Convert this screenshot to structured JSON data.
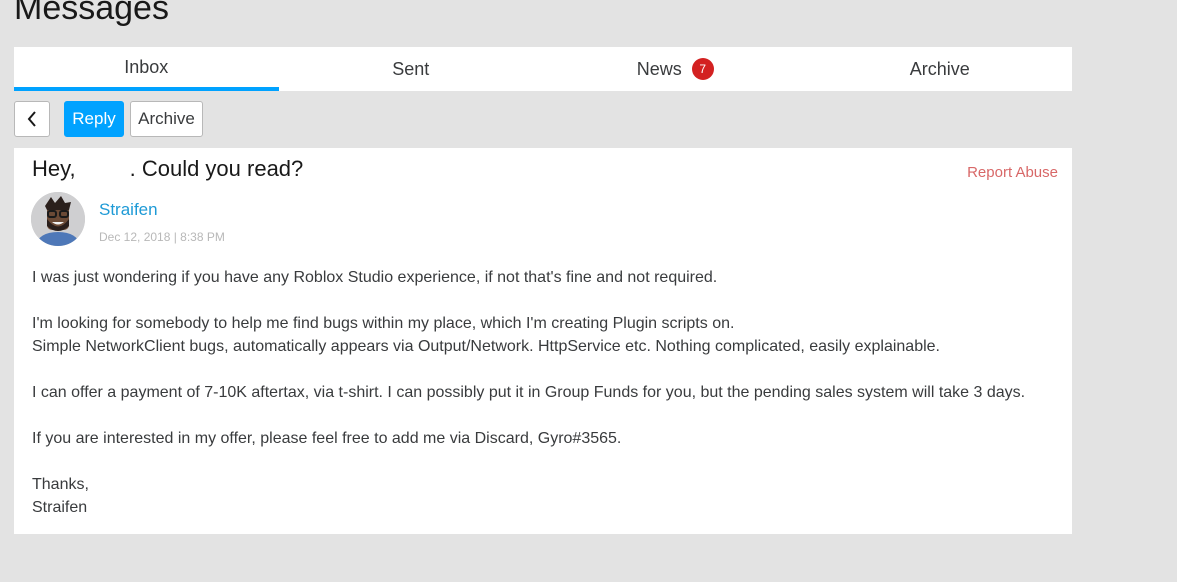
{
  "page": {
    "title": "Messages"
  },
  "tabs": [
    {
      "label": "Inbox",
      "active": true
    },
    {
      "label": "Sent",
      "active": false
    },
    {
      "label": "News",
      "active": false,
      "badge": "7"
    },
    {
      "label": "Archive",
      "active": false
    }
  ],
  "toolbar": {
    "back_icon": "chevron-left-icon",
    "reply_label": "Reply",
    "archive_label": "Archive"
  },
  "message": {
    "subject_prefix": "Hey,",
    "subject_suffix": ". Could you read?",
    "report_label": "Report Abuse",
    "sender": "Straifen",
    "date": "Dec 12, 2018 | 8:38 PM",
    "body": [
      "I was just wondering if you have any Roblox Studio experience, if not that's fine and not required.",
      "",
      "I'm looking for somebody to help me find bugs within my place, which I'm creating Plugin scripts on.",
      "Simple NetworkClient bugs, automatically appears via Output/Network. HttpService etc. Nothing complicated, easily explainable.",
      "",
      "I can offer a payment of 7-10K aftertax, via t-shirt. I can possibly put it in Group Funds for you, but the pending sales system will take 3 days.",
      "",
      "If you are interested in my offer, please feel free to add me via Discard, Gyro#3565.",
      "",
      "Thanks,",
      "Straifen"
    ]
  },
  "colors": {
    "accent": "#00a2ff",
    "badge": "#d32121",
    "report": "#d86868",
    "link": "#1e9ad6",
    "background": "#e3e3e3"
  }
}
